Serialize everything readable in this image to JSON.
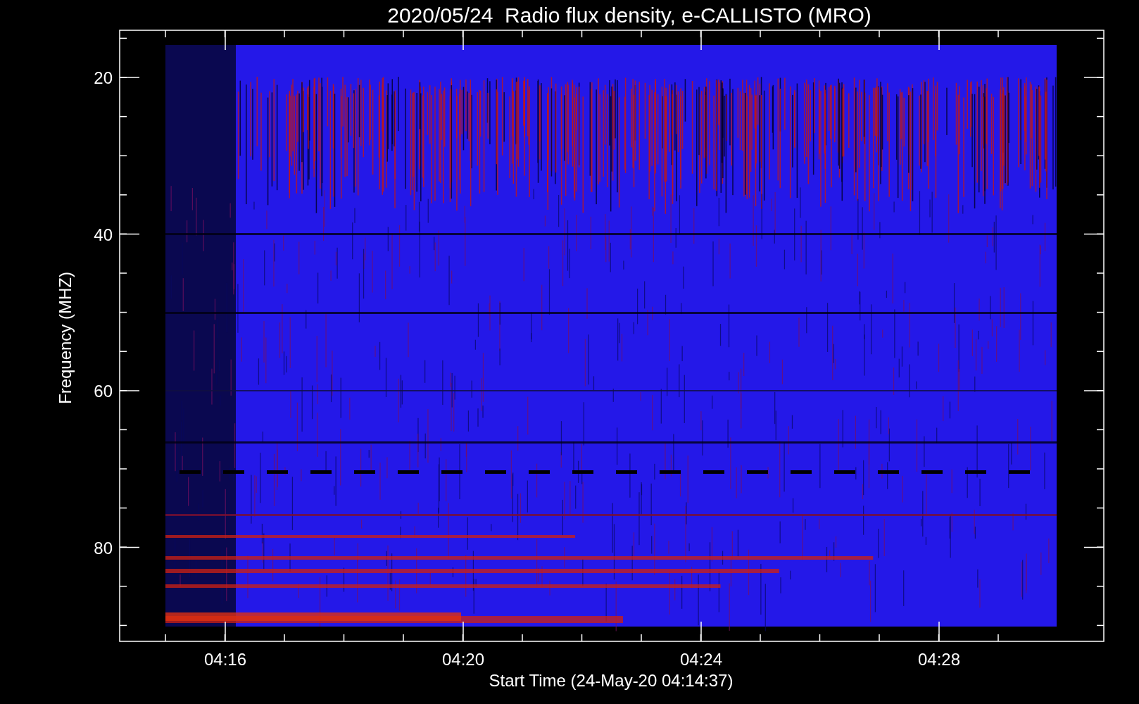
{
  "title": "2020/05/24  Radio flux density, e-CALLISTO (MRO)",
  "y_axis": {
    "label": "Frequency (MHZ)",
    "ticks": [
      "20",
      "40",
      "60",
      "80"
    ]
  },
  "x_axis": {
    "label": "Start Time (24-May-20 04:14:37)",
    "ticks": [
      "04:16",
      "04:20",
      "04:24",
      "04:28"
    ]
  }
}
